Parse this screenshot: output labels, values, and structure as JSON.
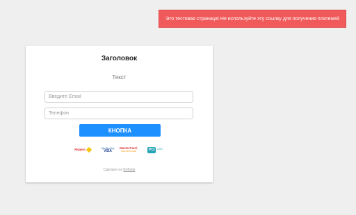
{
  "banner": {
    "text": "Это тестовая страница! Не используйте эту ссылку для получения платежей",
    "color": "#f05a5a"
  },
  "card": {
    "title": "Заголовок",
    "subtitle": "Текст"
  },
  "form": {
    "email_placeholder": "Введите Email",
    "email_value": "",
    "phone_placeholder": "Телефон",
    "phone_value": "",
    "submit_label": "КНОПКА",
    "accent_color": "#1e90ff"
  },
  "payments": {
    "yandex": "Яндекс",
    "verified_by": "Verified by",
    "visa": "VISA",
    "mastercard": "MasterCard.",
    "securecode": "SecureCode",
    "pci": "PCI",
    "dss": "DSS"
  },
  "footer": {
    "prefix": "Сделано на",
    "link_label": "Bothelp"
  }
}
